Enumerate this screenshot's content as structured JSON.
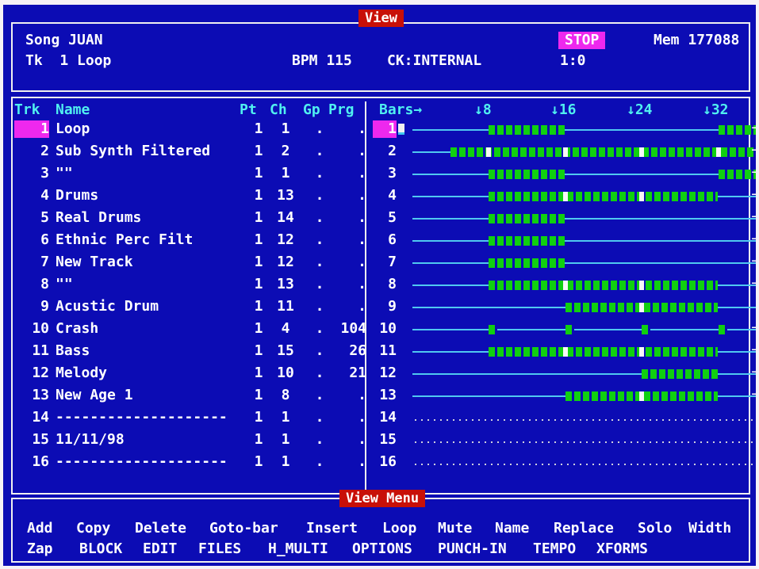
{
  "window": {
    "title": "View",
    "menu_title": "View Menu"
  },
  "header": {
    "song_label": "Song JUAN",
    "track_label": "Tk  1 Loop",
    "bpm": "BPM 115",
    "clock": "CK:INTERNAL",
    "status": "STOP",
    "position": "1:0",
    "memory": "Mem 177088"
  },
  "columns": {
    "trk": "Trk",
    "name": "Name",
    "pt": "Pt",
    "ch": "Ch",
    "gp": "Gp",
    "prg": "Prg",
    "bars": "Bars→",
    "marks": [
      "↓8",
      "↓16",
      "↓24",
      "↓32"
    ]
  },
  "tracks": [
    {
      "num": "1",
      "name": "Loop",
      "pt": "1",
      "ch": "1",
      "gp": ".",
      "prg": "."
    },
    {
      "num": "2",
      "name": "Sub Synth Filtered",
      "pt": "1",
      "ch": "2",
      "gp": ".",
      "prg": "."
    },
    {
      "num": "3",
      "name": "\"\"",
      "pt": "1",
      "ch": "1",
      "gp": ".",
      "prg": "."
    },
    {
      "num": "4",
      "name": "Drums",
      "pt": "1",
      "ch": "13",
      "gp": ".",
      "prg": "."
    },
    {
      "num": "5",
      "name": "Real Drums",
      "pt": "1",
      "ch": "14",
      "gp": ".",
      "prg": "."
    },
    {
      "num": "6",
      "name": "Ethnic Perc Filt",
      "pt": "1",
      "ch": "12",
      "gp": ".",
      "prg": "."
    },
    {
      "num": "7",
      "name": "New Track",
      "pt": "1",
      "ch": "12",
      "gp": ".",
      "prg": "."
    },
    {
      "num": "8",
      "name": "\"\"",
      "pt": "1",
      "ch": "13",
      "gp": ".",
      "prg": "."
    },
    {
      "num": "9",
      "name": "Acustic Drum",
      "pt": "1",
      "ch": "11",
      "gp": ".",
      "prg": "."
    },
    {
      "num": "10",
      "name": "Crash",
      "pt": "1",
      "ch": "4",
      "gp": ".",
      "prg": "104"
    },
    {
      "num": "11",
      "name": "Bass",
      "pt": "1",
      "ch": "15",
      "gp": ".",
      "prg": "26"
    },
    {
      "num": "12",
      "name": "Melody",
      "pt": "1",
      "ch": "10",
      "gp": ".",
      "prg": "21"
    },
    {
      "num": "13",
      "name": "New Age 1",
      "pt": "1",
      "ch": "8",
      "gp": ".",
      "prg": "."
    },
    {
      "num": "14",
      "name": "--------------------",
      "pt": "1",
      "ch": "1",
      "gp": ".",
      "prg": "."
    },
    {
      "num": "15",
      "name": "11/11/98",
      "pt": "1",
      "ch": "1",
      "gp": ".",
      "prg": "."
    },
    {
      "num": "16",
      "name": "--------------------",
      "pt": "1",
      "ch": "1",
      "gp": ".",
      "prg": "."
    }
  ],
  "lanes": [
    {
      "line": "solid",
      "arrow": true,
      "segs": [
        [
          8,
          15
        ],
        [
          32,
          35
        ]
      ]
    },
    {
      "line": "solid",
      "arrow": true,
      "segs": [
        [
          4,
          35
        ]
      ]
    },
    {
      "line": "solid",
      "arrow": true,
      "segs": [
        [
          8,
          15
        ],
        [
          32,
          35
        ]
      ]
    },
    {
      "line": "solid",
      "arrow": true,
      "segs": [
        [
          8,
          31
        ]
      ]
    },
    {
      "line": "solid",
      "arrow": true,
      "segs": [
        [
          8,
          15
        ]
      ]
    },
    {
      "line": "solid",
      "arrow": true,
      "segs": [
        [
          8,
          15
        ]
      ]
    },
    {
      "line": "solid",
      "arrow": true,
      "segs": [
        [
          8,
          15
        ]
      ]
    },
    {
      "line": "solid",
      "arrow": true,
      "segs": [
        [
          8,
          31
        ]
      ]
    },
    {
      "line": "solid",
      "arrow": false,
      "segs": [
        [
          16,
          31
        ]
      ]
    },
    {
      "line": "solid",
      "arrow": true,
      "segs": [
        [
          8,
          8
        ],
        [
          16,
          16
        ],
        [
          24,
          24
        ],
        [
          32,
          32
        ]
      ]
    },
    {
      "line": "solid",
      "arrow": true,
      "segs": [
        [
          8,
          31
        ]
      ]
    },
    {
      "line": "solid",
      "arrow": true,
      "segs": [
        [
          24,
          31
        ]
      ]
    },
    {
      "line": "solid",
      "arrow": true,
      "segs": [
        [
          16,
          31
        ]
      ]
    },
    {
      "line": "dots",
      "arrow": false,
      "segs": []
    },
    {
      "line": "dots",
      "arrow": false,
      "segs": []
    },
    {
      "line": "dots",
      "arrow": false,
      "segs": []
    }
  ],
  "menu": {
    "row1": [
      "Add",
      "Copy",
      "Delete",
      "Goto-bar",
      "Insert",
      "Loop",
      "Mute",
      "Name",
      "Replace",
      "Solo",
      "Width"
    ],
    "row2": [
      "Zap",
      "BLOCK",
      "EDIT",
      "FILES",
      "H_MULTI",
      "OPTIONS",
      "PUNCH-IN",
      "TEMPO",
      "XFORMS"
    ]
  },
  "colors": {
    "background": "#0c0cb4",
    "title_bar": "#c81008",
    "highlight": "#ee28ee",
    "headers": "#50f0f0",
    "events": "#10d010"
  }
}
